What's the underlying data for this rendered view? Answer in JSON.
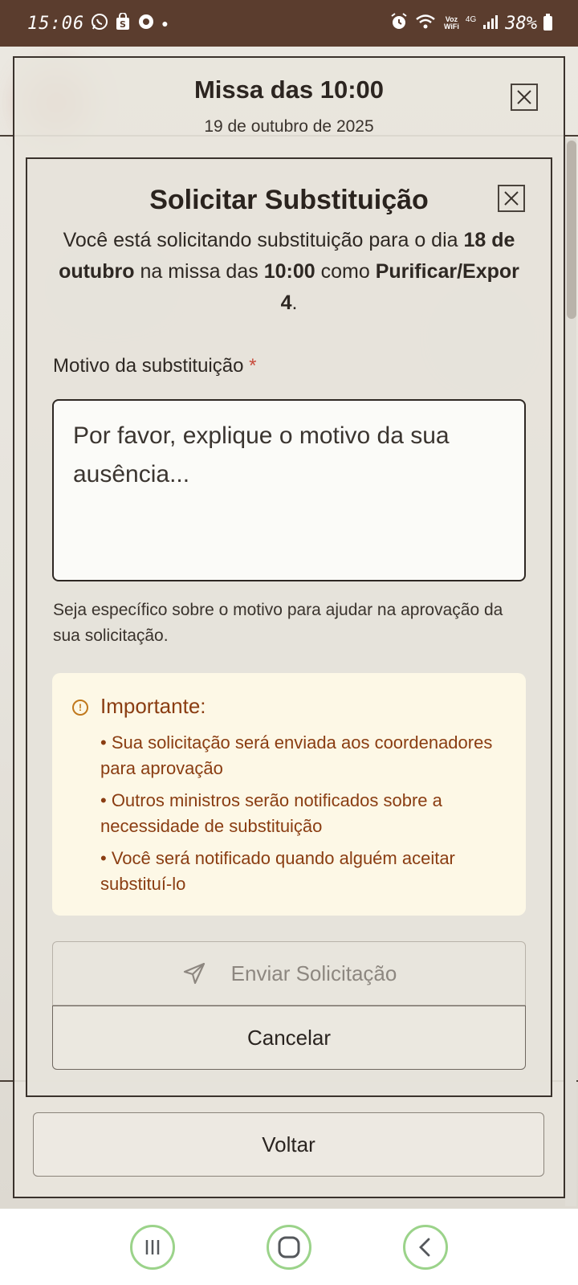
{
  "status_bar": {
    "time": "15:06",
    "voz": "Voz",
    "wifi": "WiFi",
    "network": "4G",
    "battery": "38%"
  },
  "outer_modal": {
    "title": "Missa das 10:00",
    "subtitle": "19 de outubro de 2025",
    "back_label": "Voltar"
  },
  "substitution_modal": {
    "title": "Solicitar Substituição",
    "description": {
      "part1": "Você está solicitando substituição para o dia",
      "date": "18 de outubro",
      "part2": "na missa das",
      "time": "10:00",
      "part3": "como",
      "role": "Purificar/Expor 4",
      "end": "."
    },
    "reason_label": "Motivo da substituição",
    "required_mark": "*",
    "reason_placeholder": "Por favor, explique o motivo da sua ausência...",
    "reason_value": "",
    "help_text": "Seja específico sobre o motivo para ajudar na aprovação da sua solicitação.",
    "notice": {
      "title": "Importante:",
      "items": [
        "• Sua solicitação será enviada aos coordenadores para aprovação",
        "• Outros ministros serão notificados sobre a necessidade de substituição",
        "• Você será notificado quando alguém aceitar substituí-lo"
      ]
    },
    "send_label": "Enviar Solicitação",
    "cancel_label": "Cancelar"
  },
  "colors": {
    "status_bar": "#5b3d2e",
    "notice_bg": "#fdf8e6",
    "notice_text": "#8a3d12",
    "required": "#c84b3c",
    "nav_ring": "#9bd38a"
  }
}
